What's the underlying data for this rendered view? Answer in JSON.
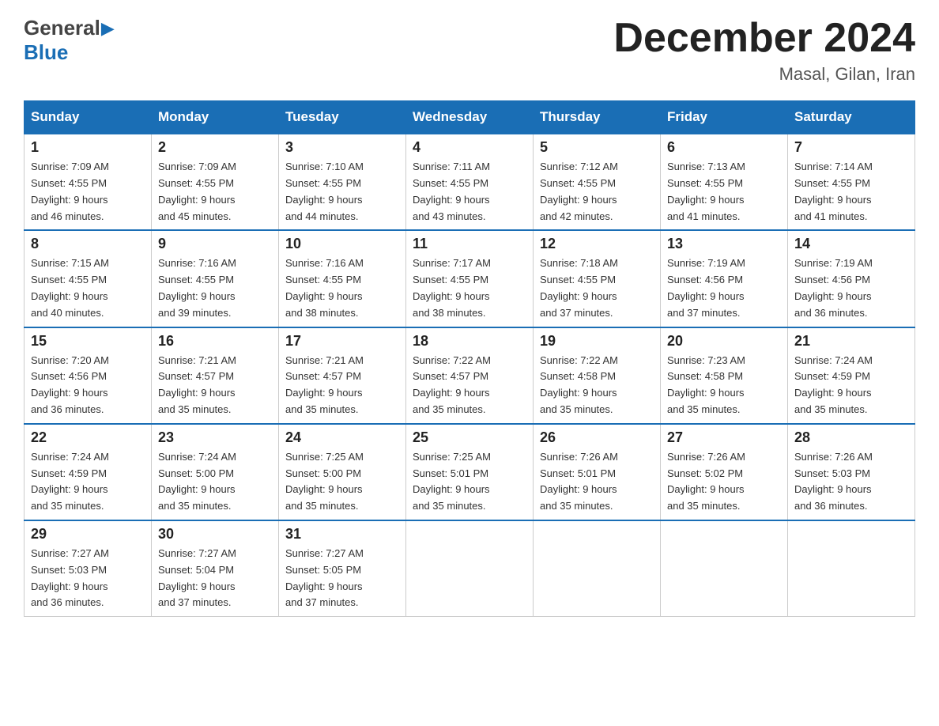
{
  "header": {
    "logo_general": "General",
    "logo_blue": "Blue",
    "month_title": "December 2024",
    "location": "Masal, Gilan, Iran"
  },
  "days_of_week": [
    "Sunday",
    "Monday",
    "Tuesday",
    "Wednesday",
    "Thursday",
    "Friday",
    "Saturday"
  ],
  "weeks": [
    [
      {
        "day": "1",
        "sunrise": "7:09 AM",
        "sunset": "4:55 PM",
        "daylight": "9 hours and 46 minutes."
      },
      {
        "day": "2",
        "sunrise": "7:09 AM",
        "sunset": "4:55 PM",
        "daylight": "9 hours and 45 minutes."
      },
      {
        "day": "3",
        "sunrise": "7:10 AM",
        "sunset": "4:55 PM",
        "daylight": "9 hours and 44 minutes."
      },
      {
        "day": "4",
        "sunrise": "7:11 AM",
        "sunset": "4:55 PM",
        "daylight": "9 hours and 43 minutes."
      },
      {
        "day": "5",
        "sunrise": "7:12 AM",
        "sunset": "4:55 PM",
        "daylight": "9 hours and 42 minutes."
      },
      {
        "day": "6",
        "sunrise": "7:13 AM",
        "sunset": "4:55 PM",
        "daylight": "9 hours and 41 minutes."
      },
      {
        "day": "7",
        "sunrise": "7:14 AM",
        "sunset": "4:55 PM",
        "daylight": "9 hours and 41 minutes."
      }
    ],
    [
      {
        "day": "8",
        "sunrise": "7:15 AM",
        "sunset": "4:55 PM",
        "daylight": "9 hours and 40 minutes."
      },
      {
        "day": "9",
        "sunrise": "7:16 AM",
        "sunset": "4:55 PM",
        "daylight": "9 hours and 39 minutes."
      },
      {
        "day": "10",
        "sunrise": "7:16 AM",
        "sunset": "4:55 PM",
        "daylight": "9 hours and 38 minutes."
      },
      {
        "day": "11",
        "sunrise": "7:17 AM",
        "sunset": "4:55 PM",
        "daylight": "9 hours and 38 minutes."
      },
      {
        "day": "12",
        "sunrise": "7:18 AM",
        "sunset": "4:55 PM",
        "daylight": "9 hours and 37 minutes."
      },
      {
        "day": "13",
        "sunrise": "7:19 AM",
        "sunset": "4:56 PM",
        "daylight": "9 hours and 37 minutes."
      },
      {
        "day": "14",
        "sunrise": "7:19 AM",
        "sunset": "4:56 PM",
        "daylight": "9 hours and 36 minutes."
      }
    ],
    [
      {
        "day": "15",
        "sunrise": "7:20 AM",
        "sunset": "4:56 PM",
        "daylight": "9 hours and 36 minutes."
      },
      {
        "day": "16",
        "sunrise": "7:21 AM",
        "sunset": "4:57 PM",
        "daylight": "9 hours and 35 minutes."
      },
      {
        "day": "17",
        "sunrise": "7:21 AM",
        "sunset": "4:57 PM",
        "daylight": "9 hours and 35 minutes."
      },
      {
        "day": "18",
        "sunrise": "7:22 AM",
        "sunset": "4:57 PM",
        "daylight": "9 hours and 35 minutes."
      },
      {
        "day": "19",
        "sunrise": "7:22 AM",
        "sunset": "4:58 PM",
        "daylight": "9 hours and 35 minutes."
      },
      {
        "day": "20",
        "sunrise": "7:23 AM",
        "sunset": "4:58 PM",
        "daylight": "9 hours and 35 minutes."
      },
      {
        "day": "21",
        "sunrise": "7:24 AM",
        "sunset": "4:59 PM",
        "daylight": "9 hours and 35 minutes."
      }
    ],
    [
      {
        "day": "22",
        "sunrise": "7:24 AM",
        "sunset": "4:59 PM",
        "daylight": "9 hours and 35 minutes."
      },
      {
        "day": "23",
        "sunrise": "7:24 AM",
        "sunset": "5:00 PM",
        "daylight": "9 hours and 35 minutes."
      },
      {
        "day": "24",
        "sunrise": "7:25 AM",
        "sunset": "5:00 PM",
        "daylight": "9 hours and 35 minutes."
      },
      {
        "day": "25",
        "sunrise": "7:25 AM",
        "sunset": "5:01 PM",
        "daylight": "9 hours and 35 minutes."
      },
      {
        "day": "26",
        "sunrise": "7:26 AM",
        "sunset": "5:01 PM",
        "daylight": "9 hours and 35 minutes."
      },
      {
        "day": "27",
        "sunrise": "7:26 AM",
        "sunset": "5:02 PM",
        "daylight": "9 hours and 35 minutes."
      },
      {
        "day": "28",
        "sunrise": "7:26 AM",
        "sunset": "5:03 PM",
        "daylight": "9 hours and 36 minutes."
      }
    ],
    [
      {
        "day": "29",
        "sunrise": "7:27 AM",
        "sunset": "5:03 PM",
        "daylight": "9 hours and 36 minutes."
      },
      {
        "day": "30",
        "sunrise": "7:27 AM",
        "sunset": "5:04 PM",
        "daylight": "9 hours and 37 minutes."
      },
      {
        "day": "31",
        "sunrise": "7:27 AM",
        "sunset": "5:05 PM",
        "daylight": "9 hours and 37 minutes."
      },
      null,
      null,
      null,
      null
    ]
  ],
  "labels": {
    "sunrise": "Sunrise:",
    "sunset": "Sunset:",
    "daylight": "Daylight:"
  }
}
